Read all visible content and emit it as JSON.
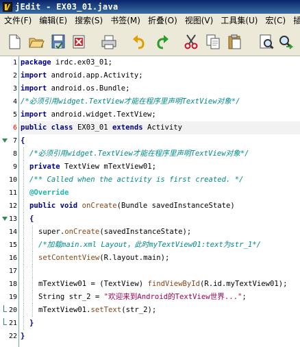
{
  "window": {
    "title": "jEdit - EX03_01.java",
    "icon": "jedit-logo-icon"
  },
  "menu": [
    {
      "id": "file",
      "label": "文件(F)"
    },
    {
      "id": "edit",
      "label": "编辑(E)"
    },
    {
      "id": "search",
      "label": "搜索(S)"
    },
    {
      "id": "markers",
      "label": "书签(M)"
    },
    {
      "id": "folding",
      "label": "折叠(O)"
    },
    {
      "id": "view",
      "label": "视图(V)"
    },
    {
      "id": "utilities",
      "label": "工具集(U)"
    },
    {
      "id": "macros",
      "label": "宏(C)"
    },
    {
      "id": "plugins",
      "label": "插"
    }
  ],
  "toolbar": [
    {
      "id": "new",
      "icon": "new-file-icon"
    },
    {
      "id": "open",
      "icon": "open-folder-icon"
    },
    {
      "id": "save",
      "icon": "save-icon"
    },
    {
      "id": "close",
      "icon": "close-file-icon"
    },
    {
      "id": "print",
      "icon": "print-icon"
    },
    {
      "id": "undo",
      "icon": "undo-icon"
    },
    {
      "id": "redo",
      "icon": "redo-icon"
    },
    {
      "id": "cut",
      "icon": "cut-icon"
    },
    {
      "id": "copy",
      "icon": "copy-icon"
    },
    {
      "id": "paste",
      "icon": "paste-icon"
    },
    {
      "id": "find",
      "icon": "find-icon"
    },
    {
      "id": "find-next",
      "icon": "find-next-icon"
    }
  ],
  "editor": {
    "current_line": 6,
    "lines": [
      {
        "n": "1",
        "indent": 0,
        "fold": "",
        "tokens": [
          {
            "c": "kw",
            "t": "package"
          },
          {
            "c": "tx",
            "t": " irdc.ex03_01;"
          }
        ]
      },
      {
        "n": "2",
        "indent": 0,
        "fold": "",
        "tokens": [
          {
            "c": "kw",
            "t": "import"
          },
          {
            "c": "tx",
            "t": " android.app.Activity;"
          }
        ]
      },
      {
        "n": "3",
        "indent": 0,
        "fold": "",
        "tokens": [
          {
            "c": "kw",
            "t": "import"
          },
          {
            "c": "tx",
            "t": " android.os.Bundle;"
          }
        ]
      },
      {
        "n": "4",
        "indent": 0,
        "fold": "",
        "tokens": [
          {
            "c": "cm",
            "t": "/*必须引用widget.TextView才能在程序里声明TextView对象*/"
          }
        ]
      },
      {
        "n": "5",
        "indent": 0,
        "fold": "",
        "tokens": [
          {
            "c": "kw",
            "t": "import"
          },
          {
            "c": "tx",
            "t": " android.widget.TextView;"
          }
        ]
      },
      {
        "n": "6",
        "indent": 0,
        "fold": "",
        "tokens": [
          {
            "c": "kw",
            "t": "public"
          },
          {
            "c": "tx",
            "t": " "
          },
          {
            "c": "kw",
            "t": "class"
          },
          {
            "c": "tx",
            "t": " EX03_01 "
          },
          {
            "c": "kw",
            "t": "extends"
          },
          {
            "c": "tx",
            "t": " Activity"
          }
        ]
      },
      {
        "n": "7",
        "indent": 0,
        "fold": "open",
        "tokens": [
          {
            "c": "kw",
            "t": "{"
          }
        ]
      },
      {
        "n": "8",
        "indent": 1,
        "fold": "",
        "tokens": [
          {
            "c": "cm",
            "t": "/*必须引用widget.TextView才能在程序里声明TextView对象*/"
          }
        ]
      },
      {
        "n": "9",
        "indent": 1,
        "fold": "",
        "tokens": [
          {
            "c": "kw",
            "t": "private"
          },
          {
            "c": "tx",
            "t": " TextView mTextView01;"
          }
        ]
      },
      {
        "n": "10",
        "indent": 1,
        "fold": "",
        "tokens": [
          {
            "c": "cm2",
            "t": "/** Called when the activity is first created. */"
          }
        ]
      },
      {
        "n": "11",
        "indent": 1,
        "fold": "",
        "tokens": [
          {
            "c": "an",
            "t": "@Override"
          }
        ]
      },
      {
        "n": "12",
        "indent": 1,
        "fold": "",
        "tokens": [
          {
            "c": "kw",
            "t": "public"
          },
          {
            "c": "tx",
            "t": " "
          },
          {
            "c": "kw",
            "t": "void"
          },
          {
            "c": "tx",
            "t": " "
          },
          {
            "c": "fn",
            "t": "onCreate"
          },
          {
            "c": "tx",
            "t": "(Bundle savedInstanceState)"
          }
        ]
      },
      {
        "n": "13",
        "indent": 1,
        "fold": "open",
        "tokens": [
          {
            "c": "kw",
            "t": "{"
          }
        ]
      },
      {
        "n": "14",
        "indent": 2,
        "fold": "",
        "tokens": [
          {
            "c": "tx",
            "t": "super."
          },
          {
            "c": "fn",
            "t": "onCreate"
          },
          {
            "c": "tx",
            "t": "(savedInstanceState);"
          }
        ]
      },
      {
        "n": "15",
        "indent": 2,
        "fold": "",
        "tokens": [
          {
            "c": "cm",
            "t": "/*加载main.xml Layout，此时myTextView01:text为str_1*/"
          }
        ]
      },
      {
        "n": "16",
        "indent": 2,
        "fold": "",
        "tokens": [
          {
            "c": "fn",
            "t": "setContentView"
          },
          {
            "c": "tx",
            "t": "(R.layout.main);"
          }
        ]
      },
      {
        "n": "17",
        "indent": 2,
        "fold": "",
        "tokens": []
      },
      {
        "n": "18",
        "indent": 2,
        "fold": "",
        "tokens": [
          {
            "c": "tx",
            "t": "mTextView01 = (TextView) "
          },
          {
            "c": "fn",
            "t": "findViewById"
          },
          {
            "c": "tx",
            "t": "(R.id.myTextView01);"
          }
        ]
      },
      {
        "n": "19",
        "indent": 2,
        "fold": "",
        "tokens": [
          {
            "c": "tx",
            "t": "String str_2 = "
          },
          {
            "c": "st",
            "t": "\"欢迎来到Android的TextView世界...\""
          },
          {
            "c": "tx",
            "t": ";"
          }
        ]
      },
      {
        "n": "20",
        "indent": 2,
        "fold": "close",
        "tokens": [
          {
            "c": "tx",
            "t": "mTextView01."
          },
          {
            "c": "fn",
            "t": "setText"
          },
          {
            "c": "tx",
            "t": "(str_2);"
          }
        ]
      },
      {
        "n": "21",
        "indent": 1,
        "fold": "close",
        "tokens": [
          {
            "c": "kw",
            "t": "}"
          }
        ]
      },
      {
        "n": "22",
        "indent": 0,
        "fold": "",
        "tokens": [
          {
            "c": "kw",
            "t": "}"
          }
        ]
      }
    ]
  }
}
